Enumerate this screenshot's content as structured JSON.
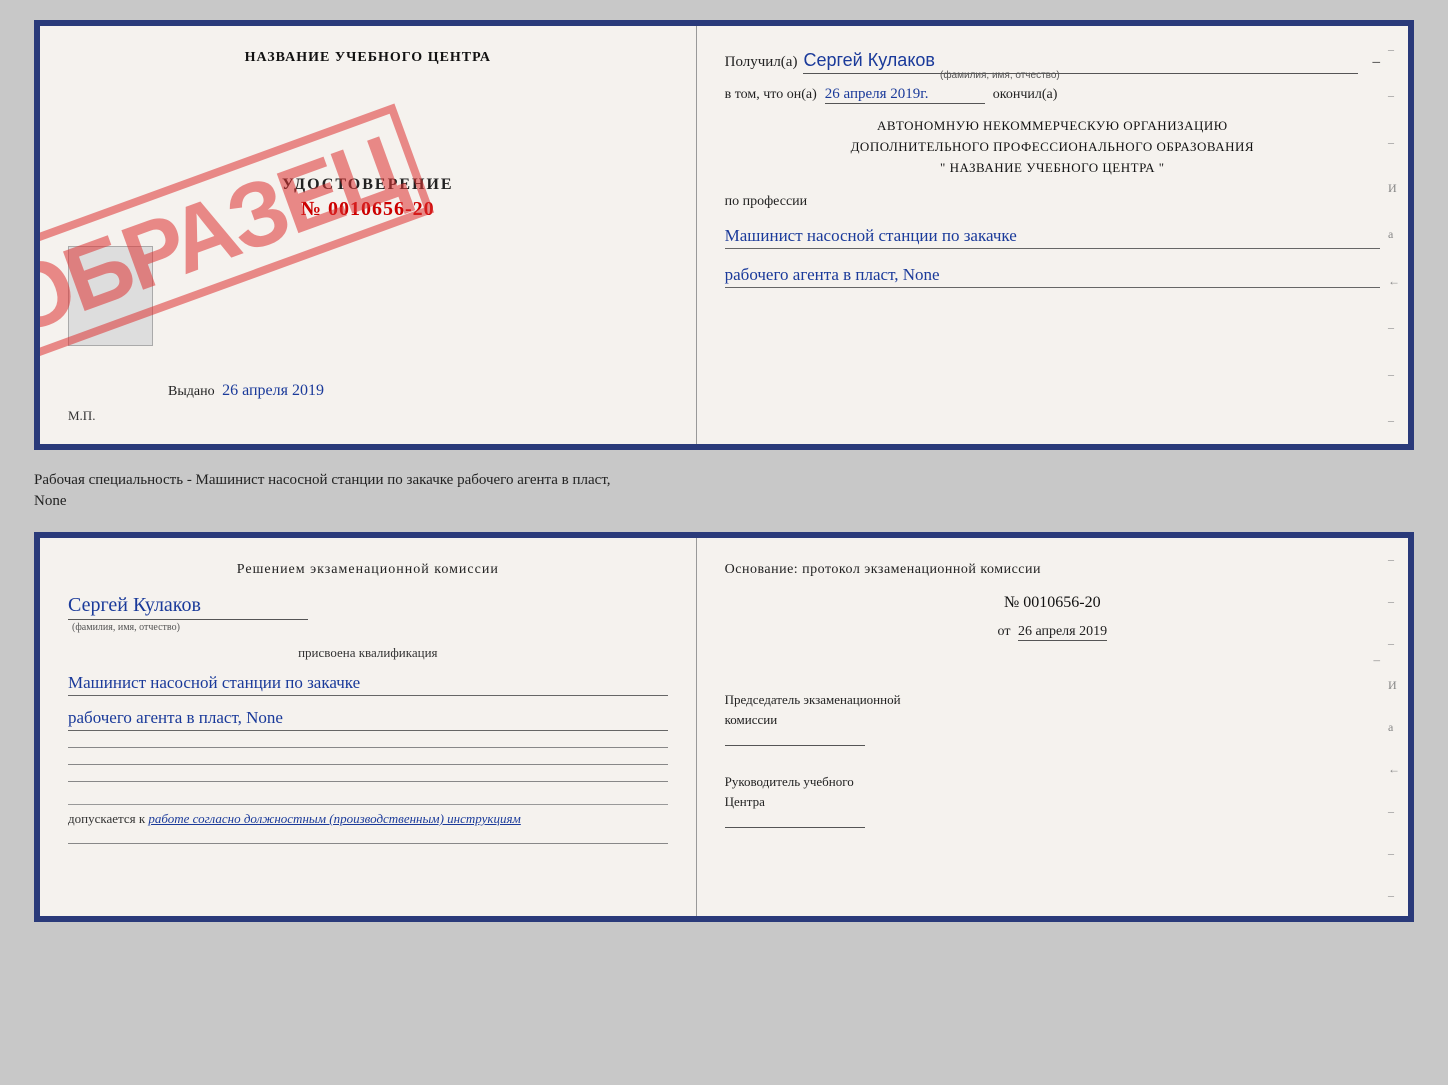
{
  "top_doc": {
    "left": {
      "center_title": "НАЗВАНИЕ УЧЕБНОГО ЦЕНТРА",
      "stamp": "ОБРАЗЕЦ",
      "udost_title": "УДОСТОВЕРЕНИЕ",
      "udost_number": "№ 0010656-20",
      "vydano_label": "Выдано",
      "vydano_date": "26 апреля 2019",
      "mp_label": "М.П."
    },
    "right": {
      "poluchil_label": "Получил(а)",
      "poluchil_name": "Сергей Кулаков",
      "poluchil_hint": "(фамилия, имя, отчество)",
      "vtom_label": "в том, что он(а)",
      "vtom_date": "26 апреля 2019г.",
      "okonchil_label": "окончил(а)",
      "org_line1": "АВТОНОМНУЮ НЕКОММЕРЧЕСКУЮ ОРГАНИЗАЦИЮ",
      "org_line2": "ДОПОЛНИТЕЛЬНОГО ПРОФЕССИОНАЛЬНОГО ОБРАЗОВАНИЯ",
      "org_line3": "\"   НАЗВАНИЕ УЧЕБНОГО ЦЕНТРА   \"",
      "po_professii_label": "по профессии",
      "profession_line1": "Машинист насосной станции по закачке",
      "profession_line2": "рабочего агента в пласт, None",
      "dashes": [
        "-",
        "-",
        "-",
        "И",
        "а",
        "←",
        "-",
        "-",
        "-"
      ]
    }
  },
  "separator": {
    "text_line1": "Рабочая специальность - Машинист насосной станции по закачке рабочего агента в пласт,",
    "text_line2": "None"
  },
  "bottom_doc": {
    "left": {
      "resheniem_text": "Решением  экзаменационной  комиссии",
      "name": "Сергей Кулаков",
      "name_hint": "(фамилия, имя, отчество)",
      "prisvoena_label": "присвоена квалификация",
      "qualification_line1": "Машинист насосной станции по закачке",
      "qualification_line2": "рабочего агента в пласт, None",
      "dopuskaetsya_label": "допускается к",
      "dopusk_italic": "работе согласно должностным (производственным) инструкциям"
    },
    "right": {
      "osnovanie_label": "Основание: протокол экзаменационной комиссии",
      "protocol_number": "№ 0010656-20",
      "ot_label": "от",
      "ot_date": "26 апреля 2019",
      "predsedatel_line1": "Председатель экзаменационной",
      "predsedatel_line2": "комиссии",
      "rukovoditel_line1": "Руководитель учебного",
      "rukovoditel_line2": "Центра",
      "dashes": [
        "-",
        "-",
        "-",
        "И",
        "а",
        "←",
        "-",
        "-",
        "-"
      ]
    }
  }
}
